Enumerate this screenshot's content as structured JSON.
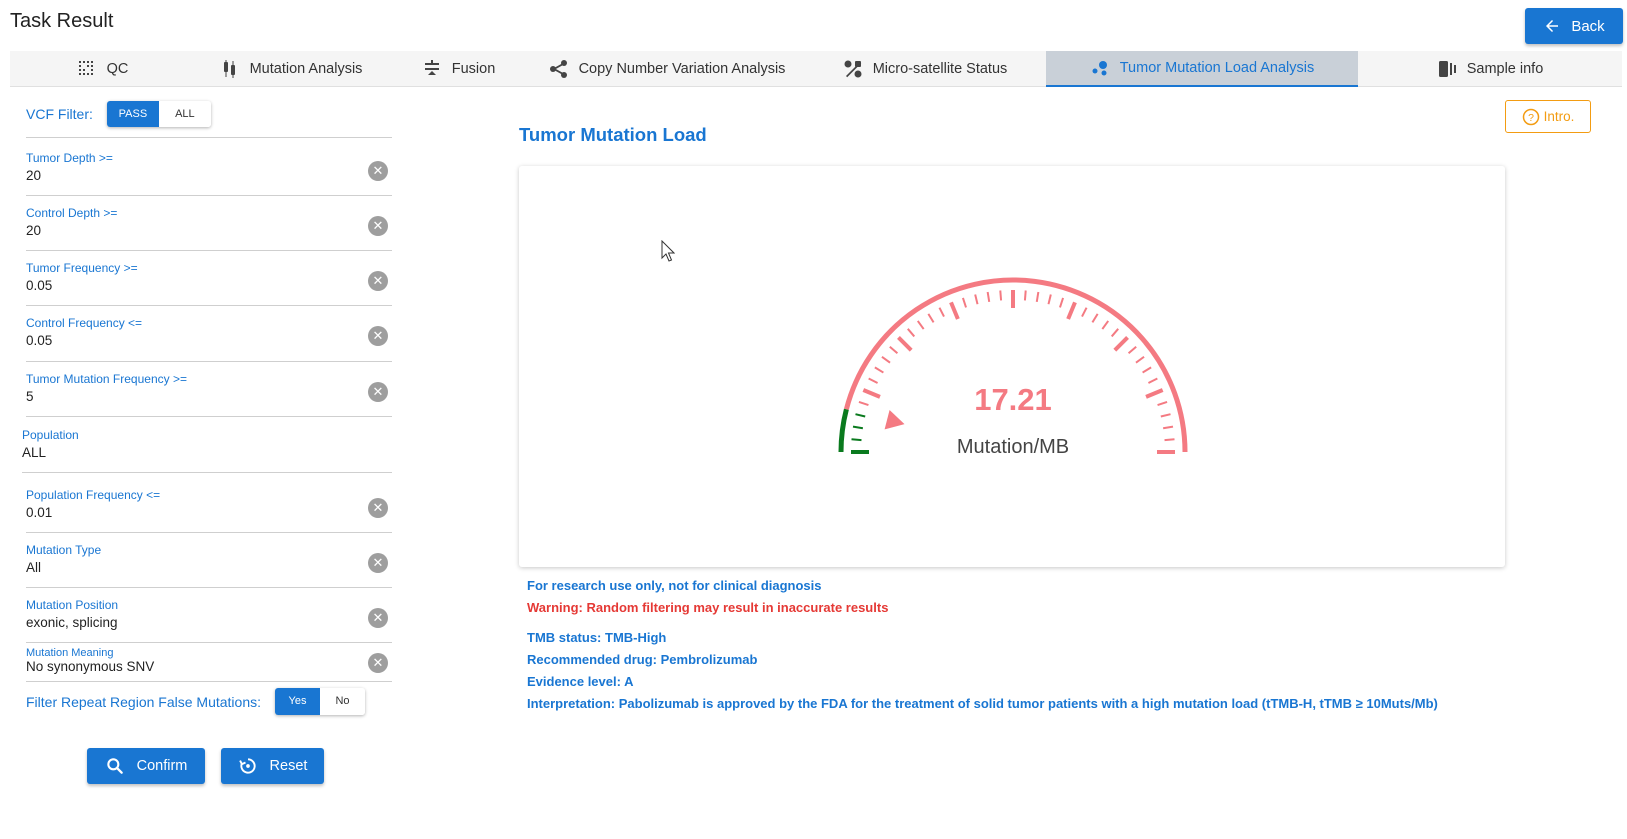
{
  "header": {
    "title": "Task Result",
    "back_label": "Back"
  },
  "tabs": [
    {
      "label": "QC",
      "icon": "qc-grid-icon",
      "active": false
    },
    {
      "label": "Mutation Analysis",
      "icon": "mutation-analysis-icon",
      "active": false
    },
    {
      "label": "Fusion",
      "icon": "fusion-icon",
      "active": false
    },
    {
      "label": "Copy Number Variation Analysis",
      "icon": "cnv-share-icon",
      "active": false
    },
    {
      "label": "Micro-satellite Status",
      "icon": "msi-icon",
      "active": false
    },
    {
      "label": "Tumor Mutation Load Analysis",
      "icon": "tmb-dots-icon",
      "active": true
    },
    {
      "label": "Sample info",
      "icon": "sample-info-icon",
      "active": false
    }
  ],
  "filters": {
    "vcf_label": "VCF Filter:",
    "vcf_options": [
      "PASS",
      "ALL"
    ],
    "vcf_selected": "PASS",
    "fields": [
      {
        "label": "Tumor Depth >=",
        "value": "20",
        "clearable": true
      },
      {
        "label": "Control Depth >=",
        "value": "20",
        "clearable": true
      },
      {
        "label": "Tumor Frequency >=",
        "value": "0.05",
        "clearable": true
      },
      {
        "label": "Control Frequency <=",
        "value": "0.05",
        "clearable": true
      },
      {
        "label": "Tumor Mutation Frequency >=",
        "value": "5",
        "clearable": true
      },
      {
        "label": "Population",
        "value": "ALL",
        "clearable": false
      },
      {
        "label": "Population Frequency <=",
        "value": "0.01",
        "clearable": true
      },
      {
        "label": "Mutation Type",
        "value": "All",
        "clearable": true
      },
      {
        "label": "Mutation Position",
        "value": "exonic, splicing",
        "clearable": true
      },
      {
        "label": "Mutation Meaning",
        "value": "No synonymous SNV",
        "clearable": true
      }
    ],
    "repeat_label": "Filter Repeat Region False Mutations:",
    "repeat_options": [
      "Yes",
      "No"
    ],
    "repeat_selected": "Yes",
    "confirm_label": "Confirm",
    "reset_label": "Reset"
  },
  "result": {
    "intro_label": "Intro.",
    "title": "Tumor Mutation Load",
    "gauge": {
      "value": "17.21",
      "unit": "Mutation/MB",
      "level_fraction": 0.08,
      "color_low": "#0a7a1e",
      "color_high": "#f47a82"
    },
    "disclaimer": "For research use only, not for clinical diagnosis",
    "warning": "Warning: Random filtering may result in inaccurate results",
    "status": "TMB status: TMB-High",
    "drug": "Recommended drug: Pembrolizumab",
    "evidence": "Evidence level: A",
    "interpretation": "Interpretation: Pabolizumab is approved by the FDA for the treatment of solid tumor patients with a high mutation load (tTMB-H, tTMB ≥ 10Muts/Mb)"
  },
  "colors": {
    "primary": "#1976d2",
    "warning": "#e53935",
    "intro": "#f39c12"
  }
}
